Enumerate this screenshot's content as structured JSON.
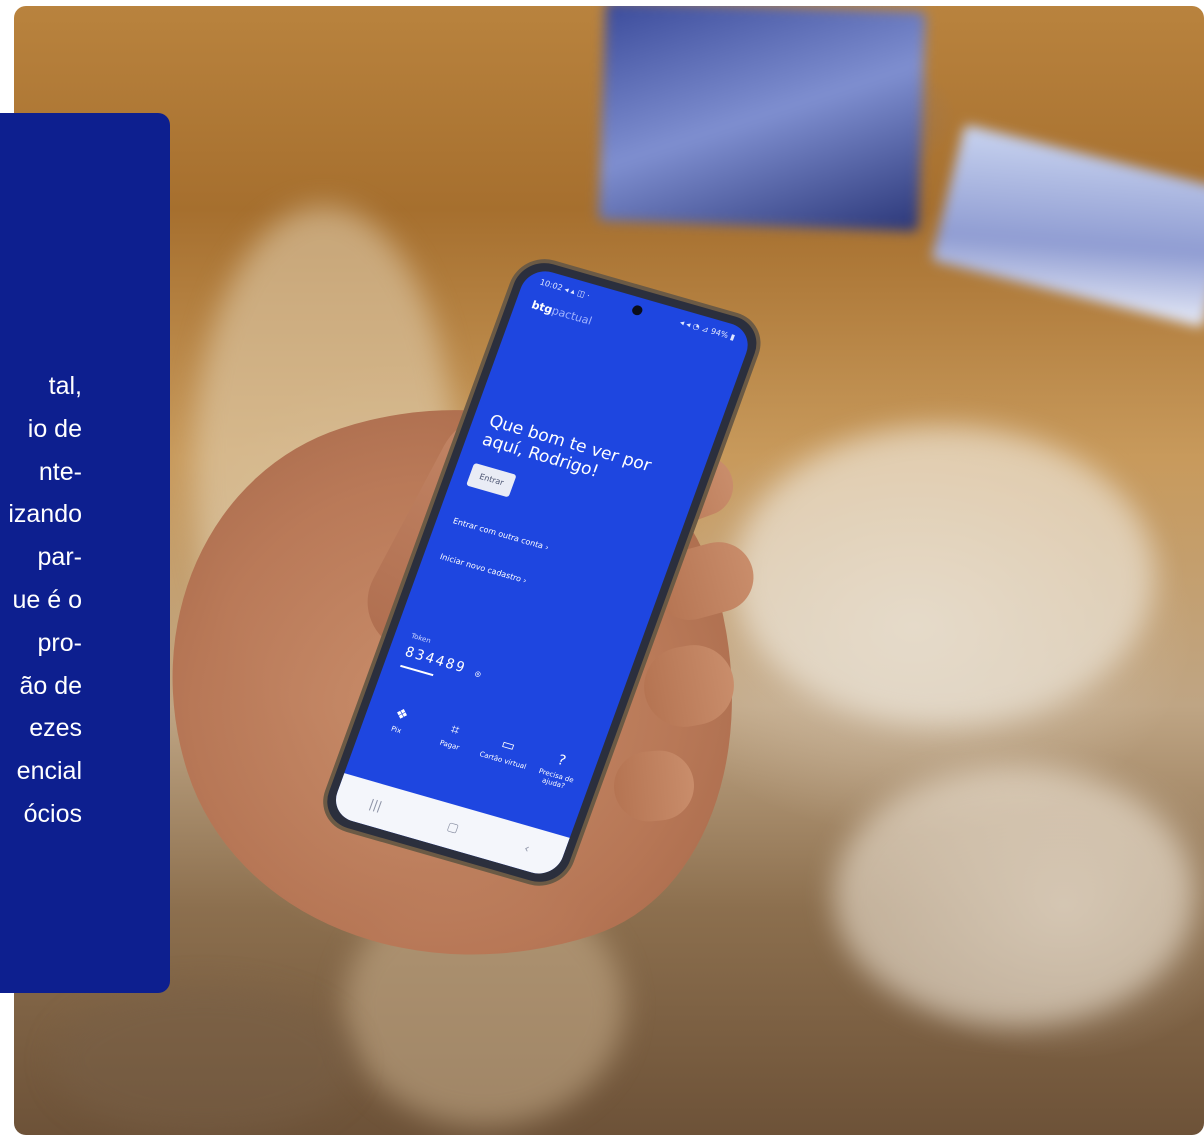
{
  "card": {
    "lines": [
      "tal,",
      "io de",
      "nte-",
      "izando",
      "par-",
      "ue é o",
      "pro-",
      "ão de",
      "ezes",
      "encial",
      "ócios"
    ]
  },
  "phone": {
    "status_left": "10:02 ◂ ▴ ◫ ·",
    "status_right": "◂ ◂ ◔ ⊿ 94% ▮",
    "brand": "btg",
    "brand_sub": "pactual",
    "greeting": "Que bom te ver por aquí, Rodrigo!",
    "enter_button": "Entrar",
    "other_account_link": "Entrar com outra conta  ›",
    "new_signup_link": "Iniciar novo cadastro  ›",
    "token_label": "Token",
    "token_value": "834489",
    "token_icon": "◎",
    "nav": [
      {
        "icon": "pix-icon",
        "glyph": "❖",
        "label": "Pix"
      },
      {
        "icon": "qr-icon",
        "glyph": "⌗",
        "label": "Pagar"
      },
      {
        "icon": "card-icon",
        "glyph": "▭",
        "label": "Cartão virtual"
      },
      {
        "icon": "help-icon",
        "glyph": "?",
        "label": "Precisa de ajuda?"
      }
    ],
    "sysnav": [
      "|||",
      "▢",
      "‹"
    ]
  },
  "colors": {
    "card_bg": "#0d1f8f",
    "screen_bg": "#1e46e0"
  }
}
